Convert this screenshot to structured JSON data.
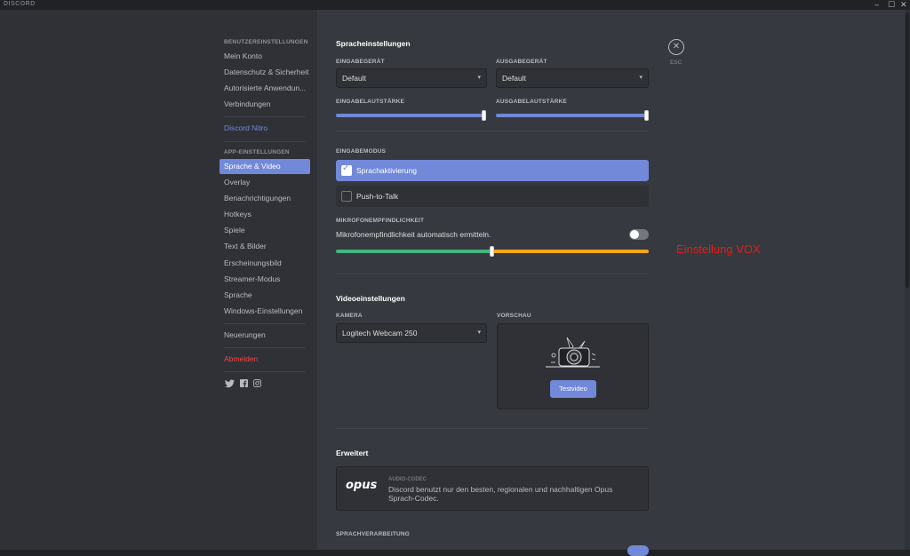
{
  "app": {
    "brand": "DISCORD",
    "win_min": "–",
    "win_max": "☐",
    "win_close": "✕"
  },
  "sidebar": {
    "user_header": "Benutzereinstellungen",
    "user_items": [
      "Mein Konto",
      "Datenschutz & Sicherheit",
      "Autorisierte Anwendun...",
      "Verbindungen"
    ],
    "nitro": "Discord Nitro",
    "app_header": "App-Einstellungen",
    "app_items": [
      "Sprache & Video",
      "Overlay",
      "Benachrichtigungen",
      "Hotkeys",
      "Spiele",
      "Text & Bilder",
      "Erscheinungsbild",
      "Streamer-Modus",
      "Sprache",
      "Windows-Einstellungen"
    ],
    "active_item": "Sprache & Video",
    "changelog": "Neuerungen",
    "logout": "Abmelden",
    "social_icons": [
      "twitter-icon",
      "facebook-icon",
      "instagram-icon"
    ]
  },
  "close": {
    "glyph": "✕",
    "label": "ESC"
  },
  "voice": {
    "title": "Spracheinstellungen",
    "input_device_label": "Eingabegerät",
    "input_device": "Default",
    "output_device_label": "Ausgabegerät",
    "output_device": "Default",
    "input_volume_label": "Eingabelautstärke",
    "input_volume": 1.0,
    "output_volume_label": "Ausgabelautstärke",
    "output_volume": 1.0,
    "mode_label": "Eingabemodus",
    "modes": [
      {
        "label": "Sprachaktivierung",
        "checked": true
      },
      {
        "label": "Push-to-Talk",
        "checked": false
      }
    ],
    "sensitivity_label": "Mikrofonempfindlichkeit",
    "sensitivity_auto": "Mikrofonempfindlichkeit automatisch ermitteln.",
    "sensitivity_auto_on": false,
    "sensitivity_level": 0.5
  },
  "annotation": "Einstellung VOX",
  "video": {
    "title": "Videoeinstellungen",
    "camera_label": "Kamera",
    "camera": "Logitech Webcam 250",
    "preview_label": "Vorschau",
    "test_button": "Testvideo"
  },
  "advanced": {
    "title": "Erweitert",
    "codec_label": "Audio-Codec",
    "codec_logo": "opus",
    "codec_desc": "Discord benutzt nur den besten, regionalen und nachhaltigen Opus Sprach-Codec.",
    "processing_label": "Sprachverarbeitung"
  },
  "colors": {
    "accent": "#7289da",
    "green": "#43b581",
    "yellow": "#faa61a",
    "danger": "#f04747",
    "annotation": "#e0201a"
  }
}
